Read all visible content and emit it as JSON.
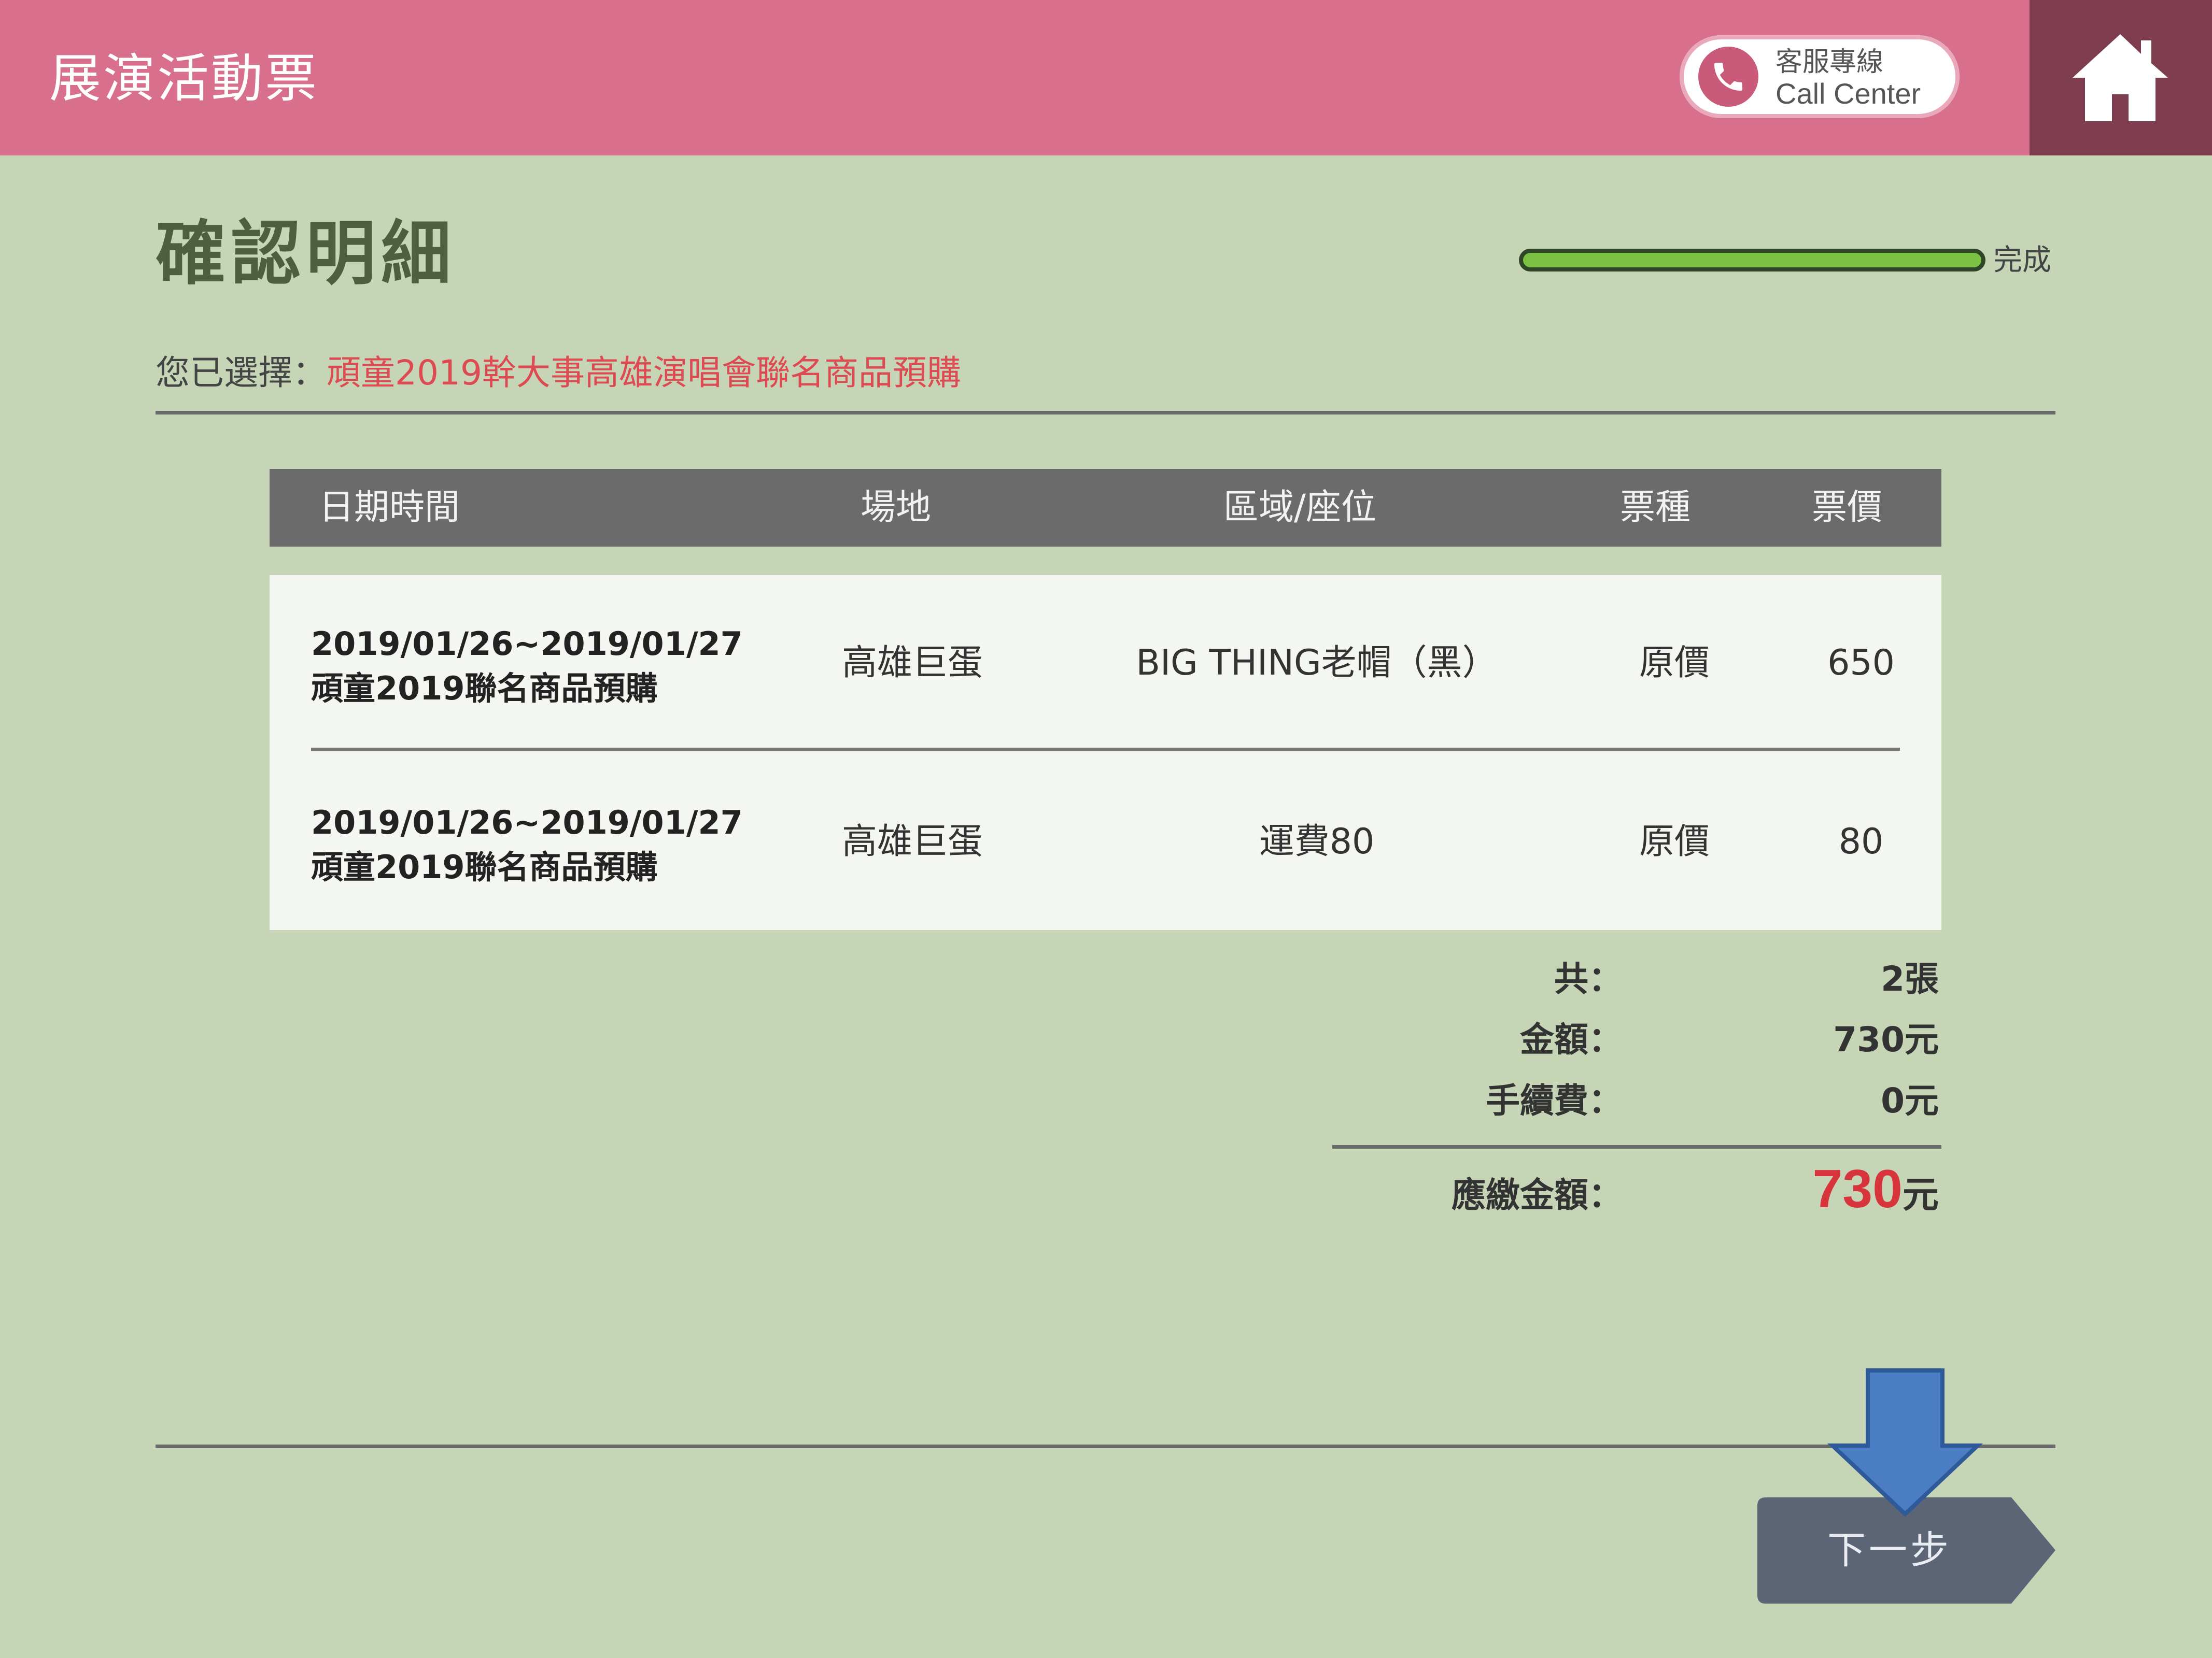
{
  "header": {
    "app_title": "展演活動票",
    "call_center_zh": "客服專線",
    "call_center_en": "Call Center"
  },
  "page": {
    "title": "確認明細",
    "progress_label": "完成",
    "progress": 1.0,
    "selected_prefix": "您已選擇：",
    "selected_event": "頑童2019幹大事高雄演唱會聯名商品預購"
  },
  "table": {
    "headers": [
      "日期時間",
      "場地",
      "區域/座位",
      "票種",
      "票價"
    ],
    "rows": [
      {
        "date": "2019/01/26~2019/01/27",
        "product": "頑童2019聯名商品預購",
        "venue": "高雄巨蛋",
        "seat": "BIG THING老帽（黑）",
        "ticket_type": "原價",
        "price": "650"
      },
      {
        "date": "2019/01/26~2019/01/27",
        "product": "頑童2019聯名商品預購",
        "venue": "高雄巨蛋",
        "seat": "運費80",
        "ticket_type": "原價",
        "price": "80"
      }
    ]
  },
  "summary": {
    "count_label": "共：",
    "count_value": "2張",
    "amount_label": "金額：",
    "amount_value": "730元",
    "fee_label": "手續費：",
    "fee_value": "0元",
    "total_label": "應繳金額：",
    "total_value": "730",
    "total_unit": "元"
  },
  "buttons": {
    "next_label": "下一步"
  },
  "colors": {
    "header_bg": "#d86f8c",
    "home_bg": "#7d3d4f",
    "page_bg": "#c5d5b6",
    "accent_red": "#de4a52",
    "progress_green": "#7ac143",
    "next_button": "#5b6575",
    "arrow_blue": "#4a7dc3"
  },
  "icons": {
    "phone": "phone-icon",
    "home": "home-icon",
    "arrow": "arrow-down-icon"
  }
}
